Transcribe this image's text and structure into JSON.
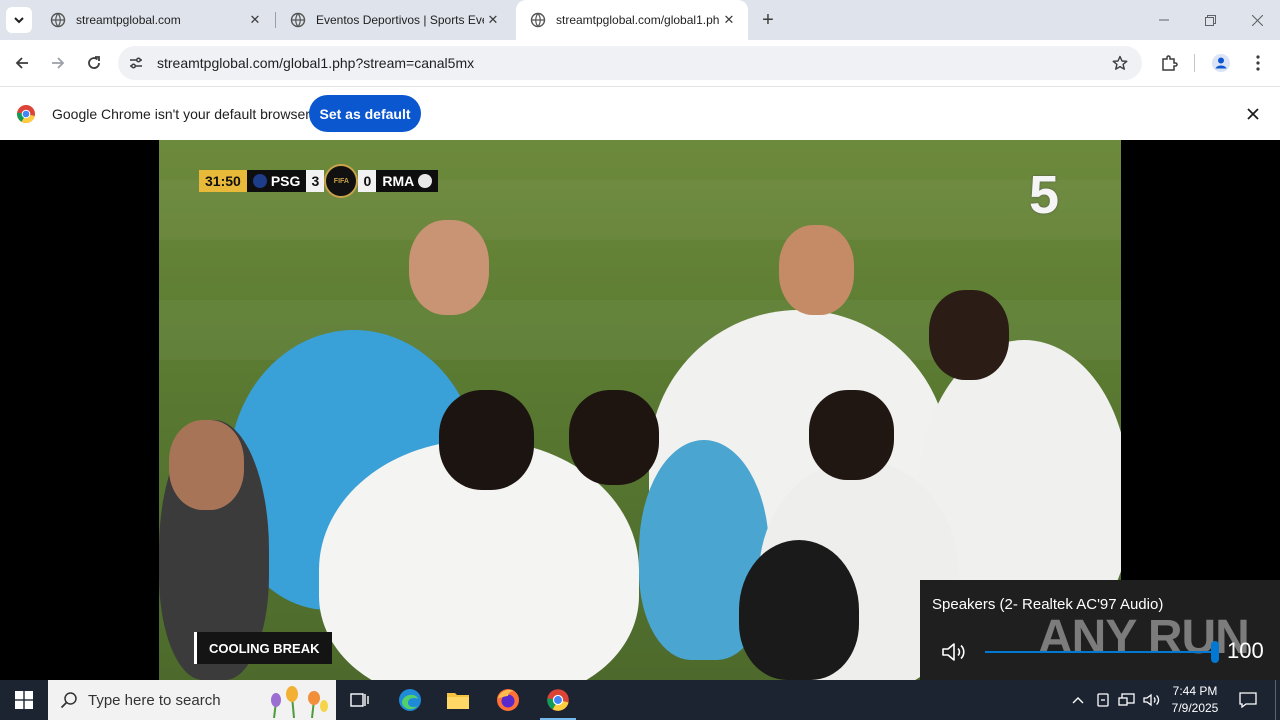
{
  "browser": {
    "tabs": [
      {
        "title": "streamtpglobal.com",
        "active": false
      },
      {
        "title": "Eventos Deportivos | Sports Eve",
        "active": false
      },
      {
        "title": "streamtpglobal.com/global1.ph",
        "active": true
      }
    ],
    "url": "streamtpglobal.com/global1.php?stream=canal5mx"
  },
  "infobar": {
    "message": "Google Chrome isn't your default browser",
    "button_label": "Set as default"
  },
  "video": {
    "scoreboard": {
      "time": "31:50",
      "home_team": "PSG",
      "home_score": "3",
      "away_score": "0",
      "away_team": "RMA",
      "badge_text": "FIFA"
    },
    "channel_logo": "5",
    "caption": "COOLING BREAK"
  },
  "volume_flyout": {
    "device": "Speakers (2- Realtek AC'97 Audio)",
    "level": 100,
    "level_text": "100",
    "watermark": "ANY RUN"
  },
  "taskbar": {
    "search_placeholder": "Type here to search",
    "time": "7:44 PM",
    "date": "7/9/2025"
  },
  "colors": {
    "tabstrip": "#dfe3eb",
    "accent_button": "#0b57d0",
    "taskbar": "#1c2431",
    "volume_accent": "#0078d4"
  }
}
